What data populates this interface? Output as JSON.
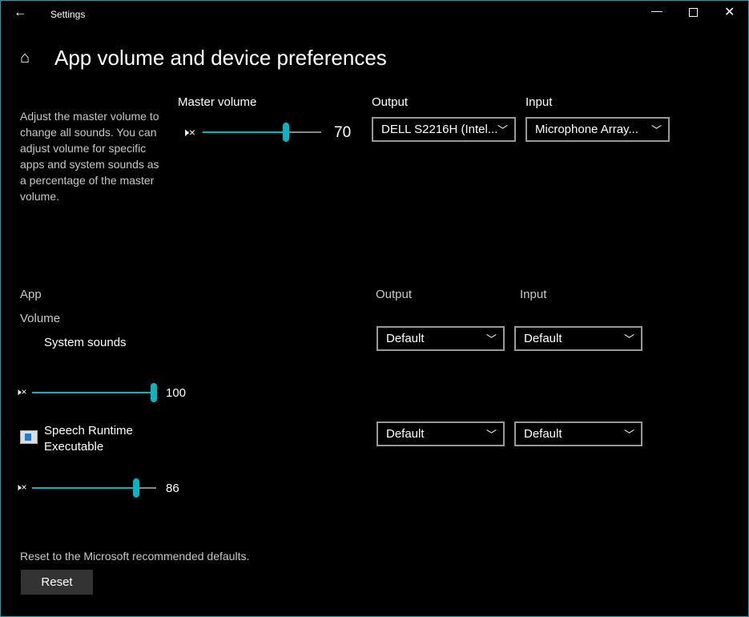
{
  "titlebar": {
    "title": "Settings",
    "back_icon": "arrow-left-icon"
  },
  "page": {
    "title": "App volume and device preferences",
    "home_icon": "home-icon"
  },
  "description": "Adjust the master volume to change all sounds. You can adjust volume for specific apps and system sounds as a percentage of the master volume.",
  "master": {
    "label": "Master volume",
    "value": 70,
    "value_text": "70",
    "output_label": "Output",
    "output_value": "DELL S2216H (Intel...",
    "input_label": "Input",
    "input_value": "Microphone Array..."
  },
  "apps_header": {
    "app": "App",
    "volume": "Volume",
    "output": "Output",
    "input": "Input"
  },
  "apps": [
    {
      "name": "System sounds",
      "value": 100,
      "value_text": "100",
      "output": "Default",
      "input": "Default"
    },
    {
      "name": "Speech Runtime Executable",
      "value": 86,
      "value_text": "86",
      "output": "Default",
      "input": "Default"
    }
  ],
  "reset": {
    "text": "Reset to the Microsoft recommended defaults.",
    "button": "Reset"
  },
  "colors": {
    "accent": "#00b7c3",
    "border": "#1aa3b4"
  }
}
